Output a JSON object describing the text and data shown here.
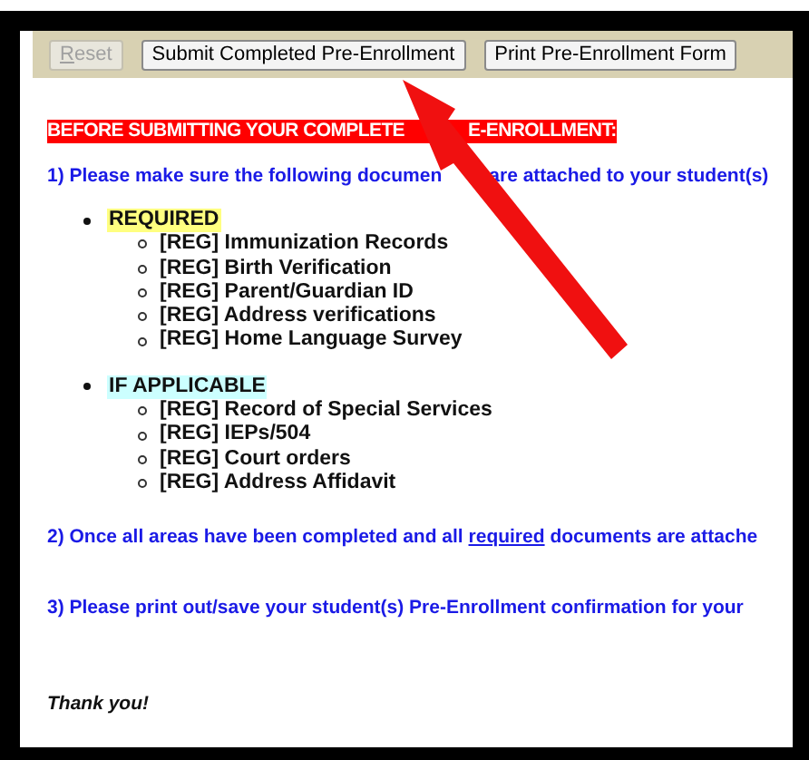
{
  "toolbar": {
    "buttons": [
      {
        "label": "Reset",
        "disabled": true,
        "accesskey_marked": true
      },
      {
        "label": "Submit Completed Pre-Enrollment",
        "disabled": false,
        "accesskey_marked": false
      },
      {
        "label": "Print Pre-Enrollment Form",
        "disabled": false,
        "accesskey_marked": false
      }
    ]
  },
  "heading": {
    "parts": [
      "BEFORE SUBMITTING YOUR COMPLETE",
      "E-ENROLLMENT:"
    ]
  },
  "step_1": {
    "parts": [
      "1) Please make sure the following documen",
      "are attached to your student(s)"
    ]
  },
  "groups": [
    {
      "title": "REQUIRED",
      "color": "#ffff80",
      "items": [
        "[REG] Immunization Records",
        "[REG] Birth Verification",
        "[REG] Parent/Guardian ID",
        "[REG] Address verifications",
        "[REG] Home Language Survey"
      ]
    },
    {
      "title": "IF APPLICABLE",
      "color": "#ccffff",
      "items": [
        "[REG] Record of Special Services",
        "[REG] IEPs/504",
        "[REG] Court orders",
        "[REG] Address Affidavit"
      ]
    }
  ],
  "step_2": {
    "before": "2) Once all areas have been completed and all ",
    "link": "required",
    "after": " documents are attache"
  },
  "step_3": "3) Please print out/save your student(s) Pre-Enrollment confirmation for your",
  "closing": "Thank you!",
  "annotation": {
    "kind": "arrow"
  }
}
